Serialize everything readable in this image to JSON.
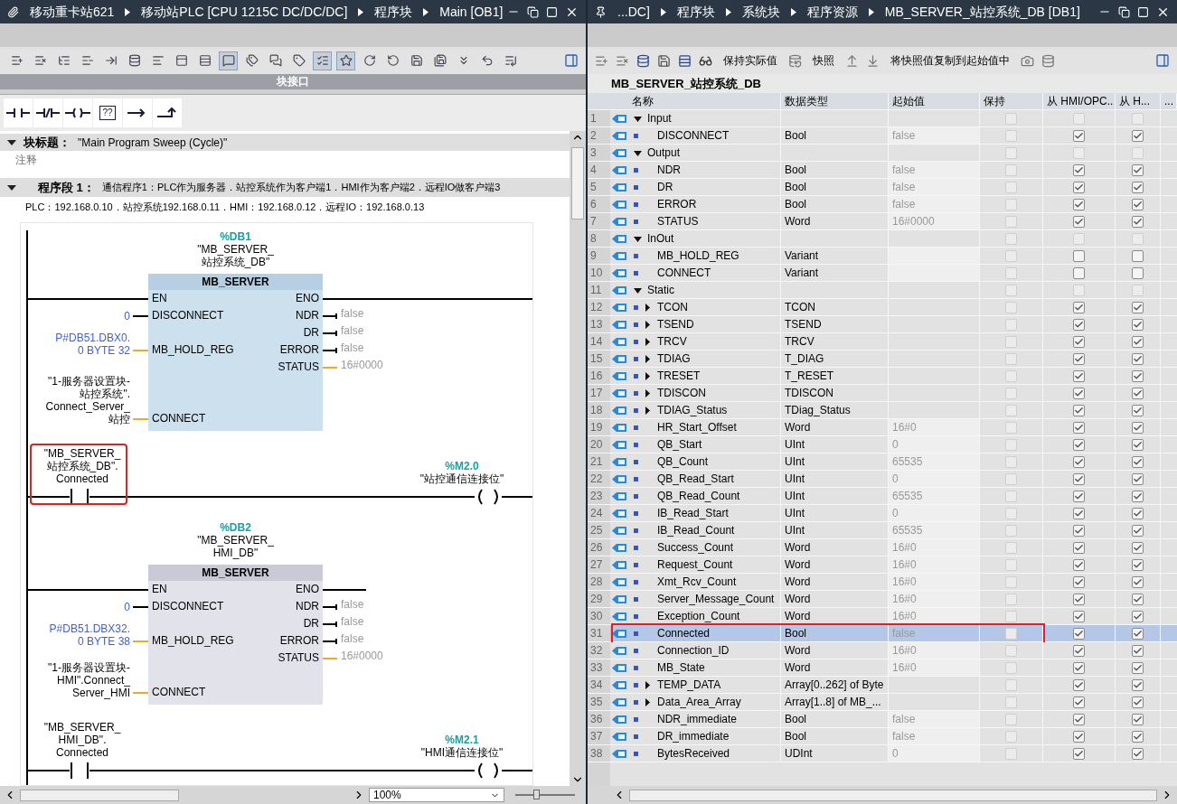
{
  "left": {
    "breadcrumb": [
      "移动重卡站621",
      "移动站PLC [CPU 1215C DC/DC/DC]",
      "程序块",
      "Main [OB1]"
    ],
    "toolbar": [
      {
        "pressed": false
      },
      {
        "pressed": false
      },
      {
        "pressed": false
      },
      {
        "pressed": false
      },
      {
        "pressed": false
      },
      {
        "pressed": false
      },
      {
        "pressed": false
      },
      {
        "pressed": false
      },
      {
        "pressed": false
      },
      {
        "pressed": true
      },
      {
        "pressed": false
      },
      {
        "pressed": false
      },
      {
        "pressed": false
      },
      {
        "pressed": true
      },
      {
        "pressed": true
      },
      {
        "pressed": false
      },
      {
        "pressed": false
      },
      {
        "pressed": false
      },
      {
        "pressed": false
      },
      {
        "pressed": false
      },
      {
        "pressed": false
      },
      {
        "pressed": false
      }
    ],
    "interface_bar": "块接口",
    "palette": [
      {
        "kind": "no_contact"
      },
      {
        "kind": "nc_contact"
      },
      {
        "kind": "coil"
      },
      {
        "kind": "empty_box",
        "label": "??"
      },
      {
        "kind": "open_branch"
      },
      {
        "kind": "close_branch"
      }
    ],
    "block_title": {
      "label": "块标题：",
      "value": "\"Main Program Sweep (Cycle)\"",
      "expanded": true
    },
    "comment_placeholder": "注释",
    "network": {
      "label": "程序段 1：",
      "title": "通信程序1：PLC作为服务器．站控系统作为客户端1．HMI作为客户端2．远程IO做客户端3",
      "comment": "PLC：192.168.0.10．站控系统192.168.0.11．HMI：192.168.0.12．远程IO：192.168.0.13",
      "expanded": true
    },
    "ladder": [
      {
        "kind": "block",
        "address": "%DB1",
        "instance": [
          "\"MB_SERVER_",
          "站控系统_DB\""
        ],
        "type": "MB_SERVER",
        "selected": true,
        "eno_connected": true,
        "inputs": [
          {
            "pin": "EN",
            "bool": true
          },
          {
            "pin": "DISCONNECT",
            "bool": true,
            "constant": true,
            "operand": [
              "0"
            ]
          },
          {
            "pin": "MB_HOLD_REG",
            "bool": false,
            "constant": true,
            "operand": [
              "P#DB51.DBX0.",
              "0 BYTE 32"
            ]
          },
          {
            "pin": "CONNECT",
            "bool": false,
            "constant": false,
            "operand": [
              "\"1-服务器设置块-",
              "站控系统\".",
              "Connect_Server_",
              "站控"
            ]
          }
        ],
        "outputs": [
          {
            "pin": "ENO",
            "bool": true
          },
          {
            "pin": "NDR",
            "bool": true,
            "value": "false"
          },
          {
            "pin": "DR",
            "bool": true,
            "value": "false"
          },
          {
            "pin": "ERROR",
            "bool": true,
            "value": "false"
          },
          {
            "pin": "STATUS",
            "bool": false,
            "value": "16#0000"
          }
        ]
      },
      {
        "kind": "rung",
        "operand": [
          "\"MB_SERVER_",
          "站控系统_DB\".",
          "Connected"
        ],
        "highlighted": true,
        "coil_address": "%M2.0",
        "coil_name": "\"站控通信连接位\""
      },
      {
        "kind": "block",
        "address": "%DB2",
        "instance": [
          "\"MB_SERVER_",
          "HMI_DB\""
        ],
        "type": "MB_SERVER",
        "selected": false,
        "eno_connected": false,
        "inputs": [
          {
            "pin": "EN",
            "bool": true
          },
          {
            "pin": "DISCONNECT",
            "bool": true,
            "constant": true,
            "operand": [
              "0"
            ]
          },
          {
            "pin": "MB_HOLD_REG",
            "bool": false,
            "constant": true,
            "operand": [
              "P#DB51.DBX32.",
              "0 BYTE 38"
            ]
          },
          {
            "pin": "CONNECT",
            "bool": false,
            "constant": false,
            "operand": [
              "\"1-服务器设置块-",
              "HMI\".Connect_",
              "Server_HMI"
            ]
          }
        ],
        "outputs": [
          {
            "pin": "ENO",
            "bool": true
          },
          {
            "pin": "NDR",
            "bool": true,
            "value": "false"
          },
          {
            "pin": "DR",
            "bool": true,
            "value": "false"
          },
          {
            "pin": "ERROR",
            "bool": true,
            "value": "false"
          },
          {
            "pin": "STATUS",
            "bool": false,
            "value": "16#0000"
          }
        ]
      },
      {
        "kind": "rung",
        "operand": [
          "\"MB_SERVER_",
          "HMI_DB\".",
          "Connected"
        ],
        "highlighted": false,
        "coil_address": "%M2.1",
        "coil_name": "\"HMI通信连接位\""
      }
    ],
    "zoom": "100%",
    "zoom_slider": {
      "level": 0.35
    }
  },
  "right": {
    "breadcrumb": [
      "...DC]",
      "程序块",
      "系统块",
      "程序资源",
      "MB_SERVER_站控系统_DB [DB1]"
    ],
    "toolbar_texts": [
      "保持实际值",
      "快照",
      "将快照值复制到起始值中"
    ],
    "db_title": "MB_SERVER_站控系统_DB",
    "table": {
      "columns": [
        "名称",
        "数据类型",
        "起始值",
        "保持",
        "从 HMI/OPC..",
        "从 H...",
        "..."
      ],
      "rows": [
        {
          "num": "1",
          "kind": "section",
          "expanded": true,
          "name": "Input",
          "retain": false,
          "hmi_accessible": false,
          "hmi_writable": false,
          "selected": false,
          "highlighted": false
        },
        {
          "num": "2",
          "kind": "member",
          "name": "DISCONNECT",
          "type": "Bool",
          "start": "false",
          "retain": false,
          "hmi_accessible": true,
          "hmi_writable": true,
          "selected": false,
          "highlighted": false
        },
        {
          "num": "3",
          "kind": "section",
          "expanded": true,
          "name": "Output",
          "retain": false,
          "hmi_accessible": false,
          "hmi_writable": false,
          "selected": false,
          "highlighted": false
        },
        {
          "num": "4",
          "kind": "member",
          "name": "NDR",
          "type": "Bool",
          "start": "false",
          "retain": false,
          "hmi_accessible": true,
          "hmi_writable": true,
          "selected": false,
          "highlighted": false
        },
        {
          "num": "5",
          "kind": "member",
          "name": "DR",
          "type": "Bool",
          "start": "false",
          "retain": false,
          "hmi_accessible": true,
          "hmi_writable": true,
          "selected": false,
          "highlighted": false
        },
        {
          "num": "6",
          "kind": "member",
          "name": "ERROR",
          "type": "Bool",
          "start": "false",
          "retain": false,
          "hmi_accessible": true,
          "hmi_writable": true,
          "selected": false,
          "highlighted": false
        },
        {
          "num": "7",
          "kind": "member",
          "name": "STATUS",
          "type": "Word",
          "start": "16#0000",
          "retain": false,
          "hmi_accessible": true,
          "hmi_writable": true,
          "selected": false,
          "highlighted": false
        },
        {
          "num": "8",
          "kind": "section",
          "expanded": true,
          "name": "InOut",
          "retain": false,
          "hmi_accessible": false,
          "hmi_writable": false,
          "selected": false,
          "highlighted": false
        },
        {
          "num": "9",
          "kind": "member",
          "name": "MB_HOLD_REG",
          "type": "Variant",
          "retain": false,
          "hmi_accessible": false,
          "hmi_writable": false,
          "selected": false,
          "highlighted": false
        },
        {
          "num": "10",
          "kind": "member",
          "name": "CONNECT",
          "type": "Variant",
          "retain": false,
          "hmi_accessible": false,
          "hmi_writable": false,
          "selected": false,
          "highlighted": false
        },
        {
          "num": "11",
          "kind": "section",
          "expanded": true,
          "name": "Static",
          "retain": false,
          "hmi_accessible": false,
          "hmi_writable": false,
          "selected": false,
          "highlighted": false
        },
        {
          "num": "12",
          "kind": "struct",
          "expanded": false,
          "name": "TCON",
          "type": "TCON",
          "retain": false,
          "hmi_accessible": true,
          "hmi_writable": true,
          "selected": false,
          "highlighted": false
        },
        {
          "num": "13",
          "kind": "struct",
          "expanded": false,
          "name": "TSEND",
          "type": "TSEND",
          "retain": false,
          "hmi_accessible": true,
          "hmi_writable": true,
          "selected": false,
          "highlighted": false
        },
        {
          "num": "14",
          "kind": "struct",
          "expanded": false,
          "name": "TRCV",
          "type": "TRCV",
          "retain": false,
          "hmi_accessible": true,
          "hmi_writable": true,
          "selected": false,
          "highlighted": false
        },
        {
          "num": "15",
          "kind": "struct",
          "expanded": false,
          "name": "TDIAG",
          "type": "T_DIAG",
          "retain": false,
          "hmi_accessible": true,
          "hmi_writable": true,
          "selected": false,
          "highlighted": false
        },
        {
          "num": "16",
          "kind": "struct",
          "expanded": false,
          "name": "TRESET",
          "type": "T_RESET",
          "retain": false,
          "hmi_accessible": true,
          "hmi_writable": true,
          "selected": false,
          "highlighted": false
        },
        {
          "num": "17",
          "kind": "struct",
          "expanded": false,
          "name": "TDISCON",
          "type": "TDISCON",
          "retain": false,
          "hmi_accessible": true,
          "hmi_writable": true,
          "selected": false,
          "highlighted": false
        },
        {
          "num": "18",
          "kind": "struct",
          "expanded": false,
          "name": "TDIAG_Status",
          "type": "TDiag_Status",
          "retain": false,
          "hmi_accessible": true,
          "hmi_writable": true,
          "selected": false,
          "highlighted": false
        },
        {
          "num": "19",
          "kind": "member",
          "name": "HR_Start_Offset",
          "type": "Word",
          "start": "16#0",
          "retain": false,
          "hmi_accessible": true,
          "hmi_writable": true,
          "selected": false,
          "highlighted": false
        },
        {
          "num": "20",
          "kind": "member",
          "name": "QB_Start",
          "type": "UInt",
          "start": "0",
          "retain": false,
          "hmi_accessible": true,
          "hmi_writable": true,
          "selected": false,
          "highlighted": false
        },
        {
          "num": "21",
          "kind": "member",
          "name": "QB_Count",
          "type": "UInt",
          "start": "65535",
          "retain": false,
          "hmi_accessible": true,
          "hmi_writable": true,
          "selected": false,
          "highlighted": false
        },
        {
          "num": "22",
          "kind": "member",
          "name": "QB_Read_Start",
          "type": "UInt",
          "start": "0",
          "retain": false,
          "hmi_accessible": true,
          "hmi_writable": true,
          "selected": false,
          "highlighted": false
        },
        {
          "num": "23",
          "kind": "member",
          "name": "QB_Read_Count",
          "type": "UInt",
          "start": "65535",
          "retain": false,
          "hmi_accessible": true,
          "hmi_writable": true,
          "selected": false,
          "highlighted": false
        },
        {
          "num": "24",
          "kind": "member",
          "name": "IB_Read_Start",
          "type": "UInt",
          "start": "0",
          "retain": false,
          "hmi_accessible": true,
          "hmi_writable": true,
          "selected": false,
          "highlighted": false
        },
        {
          "num": "25",
          "kind": "member",
          "name": "IB_Read_Count",
          "type": "UInt",
          "start": "65535",
          "retain": false,
          "hmi_accessible": true,
          "hmi_writable": true,
          "selected": false,
          "highlighted": false
        },
        {
          "num": "26",
          "kind": "member",
          "name": "Success_Count",
          "type": "Word",
          "start": "16#0",
          "retain": false,
          "hmi_accessible": true,
          "hmi_writable": true,
          "selected": false,
          "highlighted": false
        },
        {
          "num": "27",
          "kind": "member",
          "name": "Request_Count",
          "type": "Word",
          "start": "16#0",
          "retain": false,
          "hmi_accessible": true,
          "hmi_writable": true,
          "selected": false,
          "highlighted": false
        },
        {
          "num": "28",
          "kind": "member",
          "name": "Xmt_Rcv_Count",
          "type": "Word",
          "start": "16#0",
          "retain": false,
          "hmi_accessible": true,
          "hmi_writable": true,
          "selected": false,
          "highlighted": false
        },
        {
          "num": "29",
          "kind": "member",
          "name": "Server_Message_Count",
          "type": "Word",
          "start": "16#0",
          "retain": false,
          "hmi_accessible": true,
          "hmi_writable": true,
          "selected": false,
          "highlighted": false
        },
        {
          "num": "30",
          "kind": "member",
          "name": "Exception_Count",
          "type": "Word",
          "start": "16#0",
          "retain": false,
          "hmi_accessible": true,
          "hmi_writable": true,
          "selected": false,
          "highlighted": false
        },
        {
          "num": "31",
          "kind": "member",
          "name": "Connected",
          "type": "Bool",
          "start": "false",
          "retain": false,
          "hmi_accessible": true,
          "hmi_writable": true,
          "selected": true,
          "highlighted": true
        },
        {
          "num": "32",
          "kind": "member",
          "name": "Connection_ID",
          "type": "Word",
          "start": "16#0",
          "retain": false,
          "hmi_accessible": true,
          "hmi_writable": true,
          "selected": false,
          "highlighted": false
        },
        {
          "num": "33",
          "kind": "member",
          "name": "MB_State",
          "type": "Word",
          "start": "16#0",
          "retain": false,
          "hmi_accessible": true,
          "hmi_writable": true,
          "selected": false,
          "highlighted": false
        },
        {
          "num": "34",
          "kind": "struct",
          "expanded": false,
          "name": "TEMP_DATA",
          "type": "Array[0..262] of Byte",
          "retain": false,
          "hmi_accessible": true,
          "hmi_writable": true,
          "selected": false,
          "highlighted": false
        },
        {
          "num": "35",
          "kind": "struct",
          "expanded": false,
          "name": "Data_Area_Array",
          "type": "Array[1..8] of MB_...",
          "retain": false,
          "hmi_accessible": true,
          "hmi_writable": true,
          "selected": false,
          "highlighted": false
        },
        {
          "num": "36",
          "kind": "member",
          "name": "NDR_immediate",
          "type": "Bool",
          "start": "false",
          "retain": false,
          "hmi_accessible": true,
          "hmi_writable": true,
          "selected": false,
          "highlighted": false
        },
        {
          "num": "37",
          "kind": "member",
          "name": "DR_immediate",
          "type": "Bool",
          "start": "false",
          "retain": false,
          "hmi_accessible": true,
          "hmi_writable": true,
          "selected": false,
          "highlighted": false
        },
        {
          "num": "38",
          "kind": "member",
          "name": "BytesReceived",
          "type": "UDInt",
          "start": "0",
          "retain": false,
          "hmi_accessible": true,
          "hmi_writable": true,
          "selected": false,
          "highlighted": false
        }
      ]
    }
  }
}
